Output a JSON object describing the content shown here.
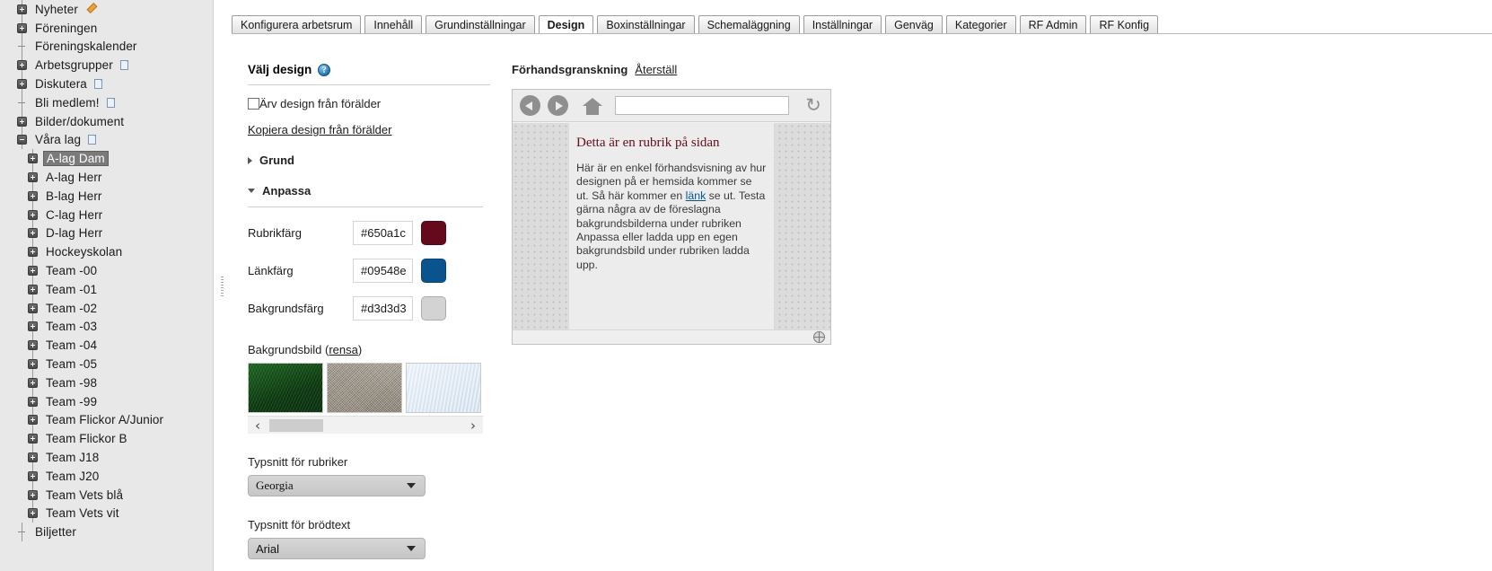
{
  "sidebar": {
    "items": [
      {
        "label": "Nyheter",
        "toggle": "plus",
        "level": 1,
        "icon": "pencil"
      },
      {
        "label": "Föreningen",
        "toggle": "plus",
        "level": 1,
        "icon": ""
      },
      {
        "label": "Föreningskalender",
        "toggle": "dash",
        "level": 1,
        "icon": ""
      },
      {
        "label": "Arbetsgrupper",
        "toggle": "plus",
        "level": 1,
        "icon": "doc"
      },
      {
        "label": "Diskutera",
        "toggle": "plus",
        "level": 1,
        "icon": "doc"
      },
      {
        "label": "Bli medlem!",
        "toggle": "dash",
        "level": 1,
        "icon": "doc"
      },
      {
        "label": "Bilder/dokument",
        "toggle": "plus",
        "level": 1,
        "icon": ""
      },
      {
        "label": "Våra lag",
        "toggle": "minus",
        "level": 1,
        "icon": "doc"
      },
      {
        "label": "A-lag Dam",
        "toggle": "plus",
        "level": 2,
        "icon": "",
        "selected": true
      },
      {
        "label": "A-lag Herr",
        "toggle": "plus",
        "level": 2,
        "icon": ""
      },
      {
        "label": "B-lag Herr",
        "toggle": "plus",
        "level": 2,
        "icon": ""
      },
      {
        "label": "C-lag Herr",
        "toggle": "plus",
        "level": 2,
        "icon": ""
      },
      {
        "label": "D-lag Herr",
        "toggle": "plus",
        "level": 2,
        "icon": ""
      },
      {
        "label": "Hockeyskolan",
        "toggle": "plus",
        "level": 2,
        "icon": ""
      },
      {
        "label": "Team -00",
        "toggle": "plus",
        "level": 2,
        "icon": ""
      },
      {
        "label": "Team -01",
        "toggle": "plus",
        "level": 2,
        "icon": ""
      },
      {
        "label": "Team -02",
        "toggle": "plus",
        "level": 2,
        "icon": ""
      },
      {
        "label": "Team -03",
        "toggle": "plus",
        "level": 2,
        "icon": ""
      },
      {
        "label": "Team -04",
        "toggle": "plus",
        "level": 2,
        "icon": ""
      },
      {
        "label": "Team -05",
        "toggle": "plus",
        "level": 2,
        "icon": ""
      },
      {
        "label": "Team -98",
        "toggle": "plus",
        "level": 2,
        "icon": ""
      },
      {
        "label": "Team -99",
        "toggle": "plus",
        "level": 2,
        "icon": ""
      },
      {
        "label": "Team Flickor A/Junior",
        "toggle": "plus",
        "level": 2,
        "icon": ""
      },
      {
        "label": "Team Flickor B",
        "toggle": "plus",
        "level": 2,
        "icon": ""
      },
      {
        "label": "Team J18",
        "toggle": "plus",
        "level": 2,
        "icon": ""
      },
      {
        "label": "Team J20",
        "toggle": "plus",
        "level": 2,
        "icon": ""
      },
      {
        "label": "Team Vets blå",
        "toggle": "plus",
        "level": 2,
        "icon": ""
      },
      {
        "label": "Team Vets vit",
        "toggle": "plus",
        "level": 2,
        "icon": ""
      },
      {
        "label": "Biljetter",
        "toggle": "dash",
        "level": 1,
        "icon": ""
      }
    ]
  },
  "tabs": [
    {
      "label": "Konfigurera arbetsrum",
      "active": false
    },
    {
      "label": "Innehåll",
      "active": false
    },
    {
      "label": "Grundinställningar",
      "active": false
    },
    {
      "label": "Design",
      "active": true
    },
    {
      "label": "Boxinställningar",
      "active": false
    },
    {
      "label": "Schemaläggning",
      "active": false
    },
    {
      "label": "Inställningar",
      "active": false
    },
    {
      "label": "Genväg",
      "active": false
    },
    {
      "label": "Kategorier",
      "active": false
    },
    {
      "label": "RF Admin",
      "active": false
    },
    {
      "label": "RF Konfig",
      "active": false
    }
  ],
  "design_panel": {
    "title": "Välj design",
    "help_icon": "?",
    "inherit_checkbox_label": "Ärv design från förälder",
    "inherit_checked": false,
    "copy_link": "Kopiera design från förälder",
    "section_grund": "Grund",
    "section_anpassa": "Anpassa",
    "colors": [
      {
        "label": "Rubrikfärg",
        "value": "#650a1c",
        "swatch": "#650a1c"
      },
      {
        "label": "Länkfärg",
        "value": "#09548e",
        "swatch": "#09548e"
      },
      {
        "label": "Bakgrundsfärg",
        "value": "#d3d3d3",
        "swatch": "#d3d3d3"
      }
    ],
    "bg_image_label": "Bakgrundsbild",
    "bg_image_clear": "rensa",
    "thumbnails": [
      {
        "name": "grass-thumbnail",
        "kind": "grass"
      },
      {
        "name": "gravel-thumbnail",
        "kind": "gravel"
      },
      {
        "name": "ice-thumbnail",
        "kind": "ice"
      }
    ],
    "scroll_left": "‹",
    "scroll_right": "›",
    "heading_font_label": "Typsnitt för rubriker",
    "heading_font_value": "Georgia",
    "body_font_label": "Typsnitt för brödtext",
    "body_font_value": "Arial"
  },
  "preview": {
    "title": "Förhandsgranskning",
    "reset_label": "Återställ",
    "toolbar": {
      "back_icon": "back-arrow-icon",
      "forward_icon": "forward-arrow-icon",
      "home_icon": "home-icon",
      "reload_icon": "↻",
      "url_value": ""
    },
    "page": {
      "heading": "Detta är en rubrik på sidan",
      "body_part1": "Här är en enkel förhandsvisning av hur designen på er hemsida kommer se ut. Så här kommer en ",
      "link_text": "länk",
      "body_part2": " se ut. Testa gärna några av de föreslagna bakgrundsbilderna under rubriken Anpassa eller ladda upp en egen bakgrundsbild under rubriken ladda upp."
    }
  }
}
